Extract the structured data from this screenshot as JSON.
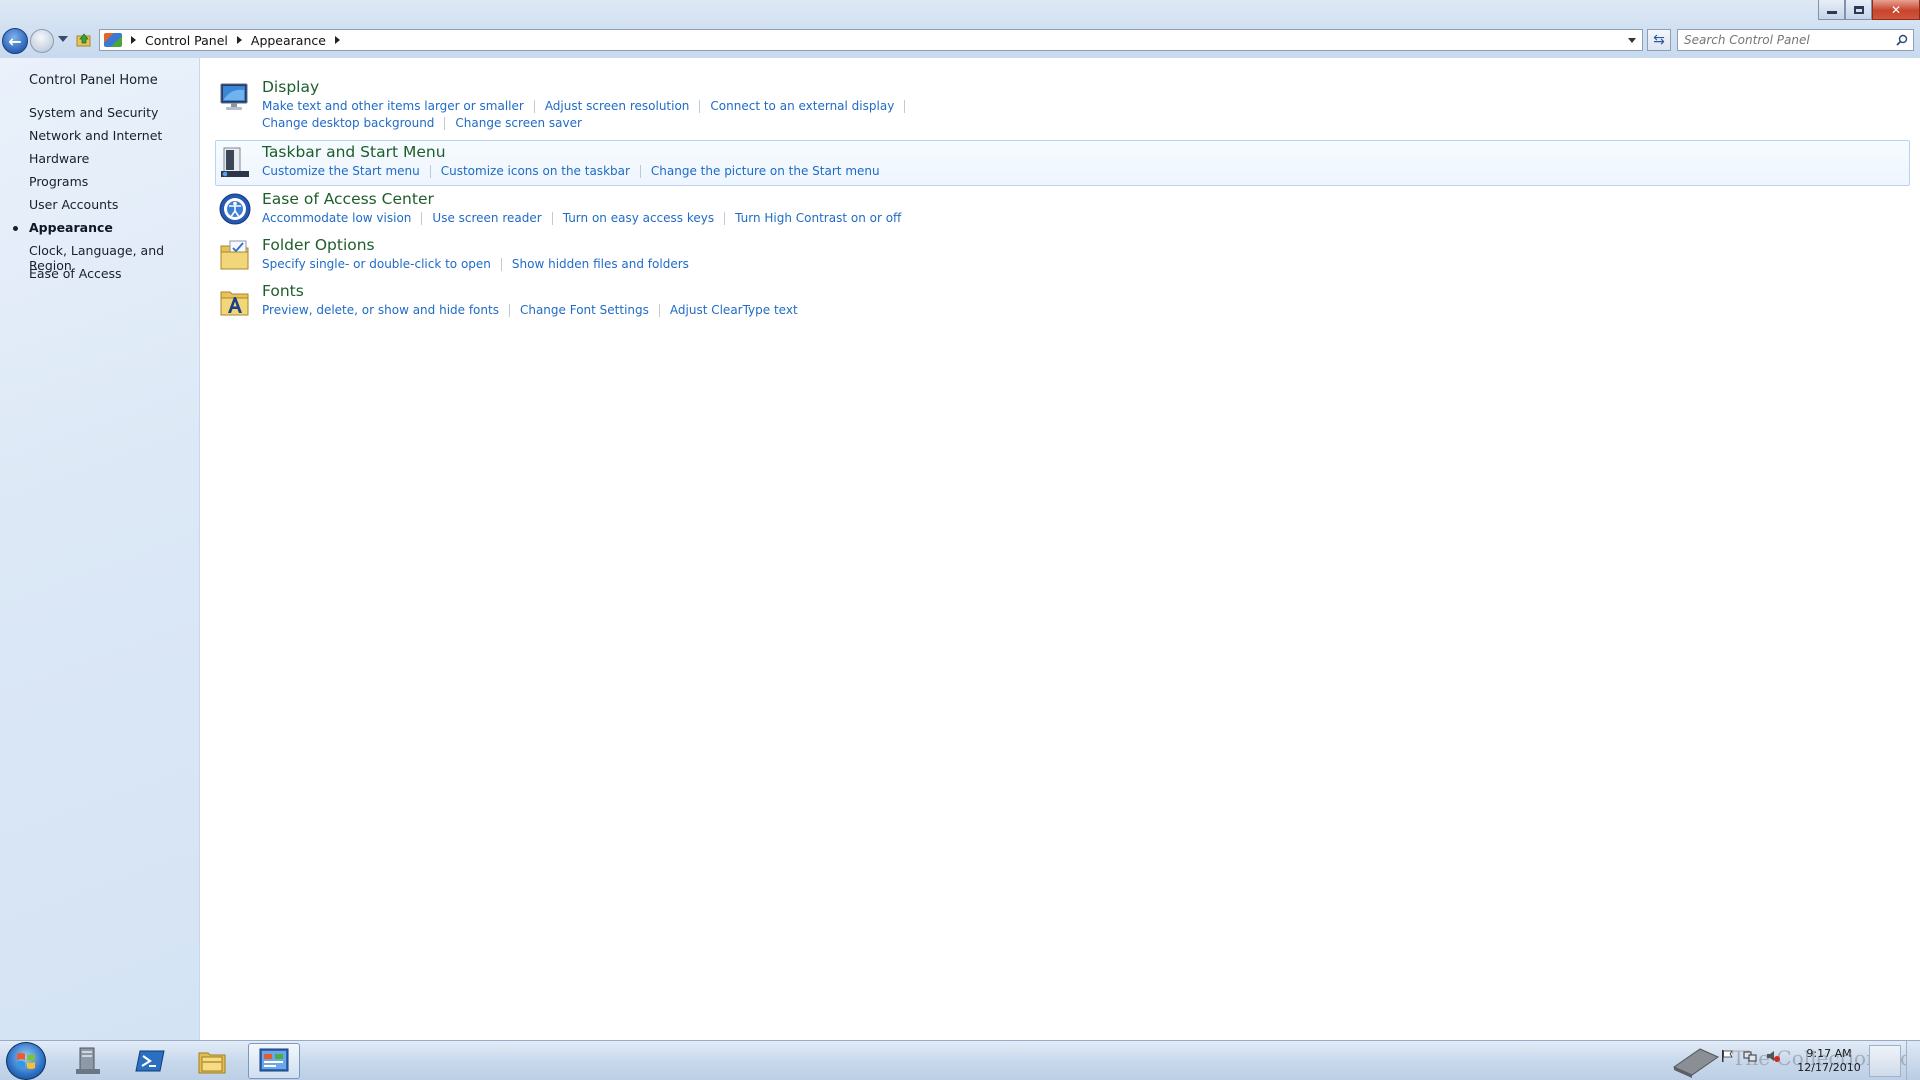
{
  "window": {
    "title": "Appearance",
    "controls": {
      "minimize_icon": "minimize-icon",
      "maximize_icon": "restore-icon",
      "close_label": "✕"
    }
  },
  "address": {
    "root_icon": "control-panel-icon",
    "crumbs": [
      "Control Panel",
      "Appearance"
    ]
  },
  "search": {
    "placeholder": "Search Control Panel"
  },
  "sidebar": {
    "home": "Control Panel Home",
    "items": [
      {
        "label": "System and Security"
      },
      {
        "label": "Network and Internet"
      },
      {
        "label": "Hardware"
      },
      {
        "label": "Programs"
      },
      {
        "label": "User Accounts"
      },
      {
        "label": "Appearance",
        "current": true
      },
      {
        "label": "Clock, Language, and Region"
      },
      {
        "label": "Ease of Access"
      }
    ]
  },
  "categories": [
    {
      "title": "Display",
      "icon": "display-icon",
      "links": [
        "Make text and other items larger or smaller",
        "Adjust screen resolution",
        "Connect to an external display"
      ],
      "links_row2": [
        "Change desktop background",
        "Change screen saver"
      ]
    },
    {
      "title": "Taskbar and Start Menu",
      "icon": "taskbar-icon",
      "links": [
        "Customize the Start menu",
        "Customize icons on the taskbar",
        "Change the picture on the Start menu"
      ]
    },
    {
      "title": "Ease of Access Center",
      "icon": "ease-of-access-icon",
      "links": [
        "Accommodate low vision",
        "Use screen reader",
        "Turn on easy access keys",
        "Turn High Contrast on or off"
      ]
    },
    {
      "title": "Folder Options",
      "icon": "folder-options-icon",
      "links": [
        "Specify single- or double-click to open",
        "Show hidden files and folders"
      ]
    },
    {
      "title": "Fonts",
      "icon": "fonts-icon",
      "links": [
        "Preview, delete, or show and hide fonts",
        "Change Font Settings",
        "Adjust ClearType text"
      ]
    }
  ],
  "taskbar": {
    "pinned": [
      "server-manager-icon",
      "powershell-icon",
      "explorer-icon",
      "control-panel-icon"
    ],
    "clock": {
      "time": "9:17 AM",
      "date": "12/17/2010"
    },
    "watermark": "The Collection Book"
  },
  "colors": {
    "link": "#1f6bc7",
    "category_title": "#1e5e2b",
    "sidebar_bg": "#dce8f6"
  }
}
